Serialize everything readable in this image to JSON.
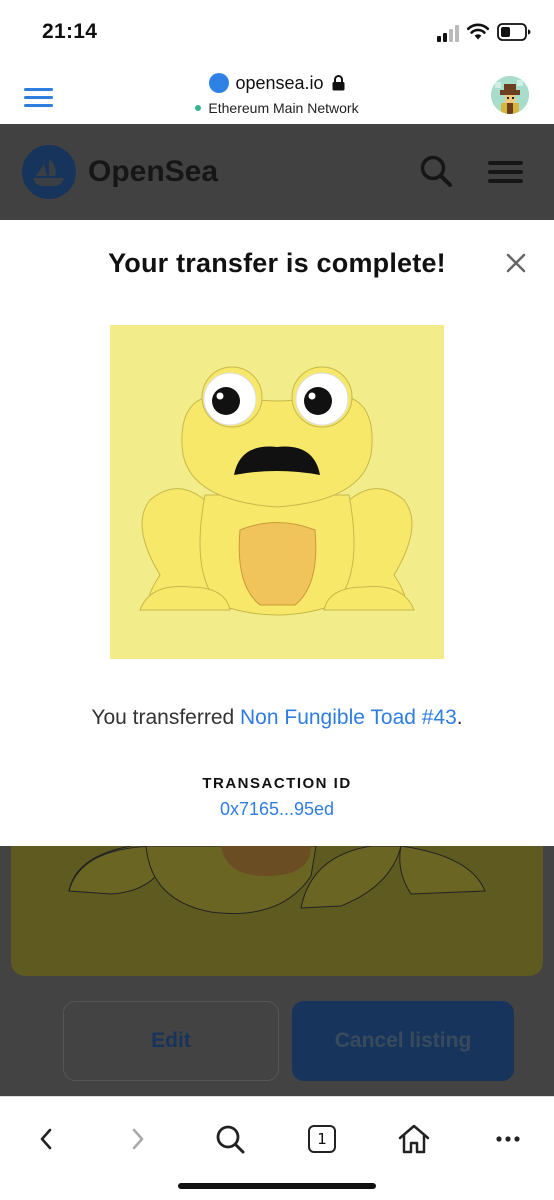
{
  "status_bar": {
    "time": "21:14"
  },
  "browser": {
    "site": "opensea.io",
    "network": "Ethereum Main Network",
    "icons": [
      "menu-icon",
      "lock-icon",
      "avatar"
    ]
  },
  "opensea_header": {
    "brand": "OpenSea"
  },
  "modal": {
    "title": "Your transfer is complete!",
    "message_prefix": "You transferred ",
    "item_link": "Non Fungible Toad #43",
    "message_suffix": ".",
    "transaction_label": "TRANSACTION ID",
    "transaction_id": "0x7165...95ed"
  },
  "listing_actions": {
    "edit_label": "Edit",
    "cancel_label": "Cancel listing"
  },
  "toolbar": {
    "tab_count": "1",
    "icons": [
      "back-icon",
      "forward-icon",
      "search-icon",
      "tabs-icon",
      "home-icon",
      "more-icon"
    ]
  },
  "colors": {
    "accent": "#2f7de1",
    "brand_dark": "#17355c",
    "nft_background": "#f2ed8a",
    "toad_body": "#f7e86a",
    "toad_belly": "#f0c45a"
  }
}
